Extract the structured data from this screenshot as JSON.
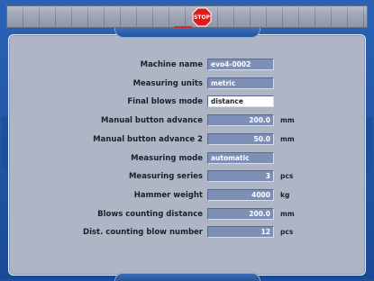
{
  "toolbar": {
    "stop_label": "STOP",
    "stop_color": "#e01b1b"
  },
  "form": {
    "rows": [
      {
        "label": "Machine name",
        "value": "evo4-0002",
        "unit": "",
        "align": "text"
      },
      {
        "label": "Measuring units",
        "value": "metric",
        "unit": "",
        "align": "text"
      },
      {
        "label": "Final blows mode",
        "value": "distance",
        "unit": "",
        "align": "text",
        "active": true
      },
      {
        "label": "Manual button advance",
        "value": "200.0",
        "unit": "mm",
        "align": "num"
      },
      {
        "label": "Manual button advance 2",
        "value": "50.0",
        "unit": "mm",
        "align": "num"
      },
      {
        "label": "Measuring mode",
        "value": "automatic",
        "unit": "",
        "align": "text"
      },
      {
        "label": "Measuring series",
        "value": "3",
        "unit": "pcs",
        "align": "num"
      },
      {
        "label": "Hammer weight",
        "value": "4000",
        "unit": "kg",
        "align": "num"
      },
      {
        "label": "Blows counting distance",
        "value": "200.0",
        "unit": "mm",
        "align": "num"
      },
      {
        "label": "Dist. counting blow number",
        "value": "12",
        "unit": "pcs",
        "align": "num"
      }
    ]
  },
  "colors": {
    "background": "#1f4f9a",
    "panel": "#aeb6c5",
    "field": "#7e8fb6",
    "field_active": "#ffffff"
  }
}
